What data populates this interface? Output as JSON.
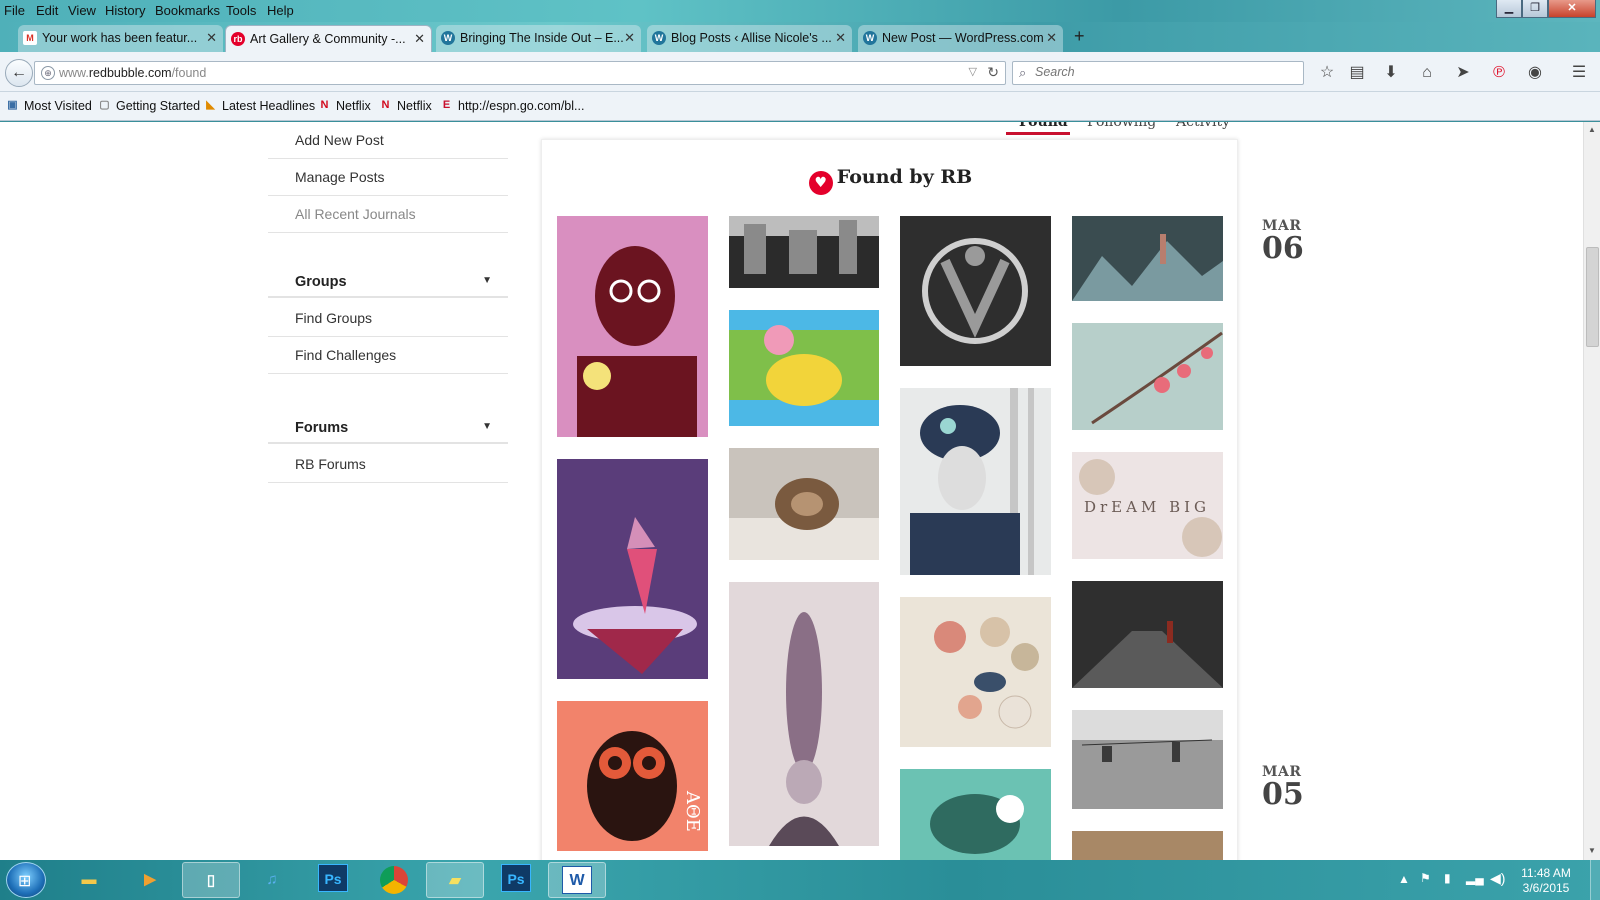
{
  "menubar": {
    "items": [
      "File",
      "Edit",
      "View",
      "History",
      "Bookmarks",
      "Tools",
      "Help"
    ],
    "window_controls": [
      "minimize",
      "restore",
      "close"
    ]
  },
  "tabs": [
    {
      "title": "Your work has been featur...",
      "icon": "gmail-icon",
      "color": "#d93025"
    },
    {
      "title": "Art Gallery & Community -...",
      "icon": "redbubble-icon",
      "color": "#e4002b"
    },
    {
      "title": "Bringing The Inside Out – E...",
      "icon": "wordpress-icon",
      "color": "#21759b"
    },
    {
      "title": "Blog Posts ‹ Allise Nicole's ...",
      "icon": "wordpress-icon",
      "color": "#21759b"
    },
    {
      "title": "New Post — WordPress.com",
      "icon": "wordpress-icon",
      "color": "#21759b"
    }
  ],
  "navbar": {
    "url_prefix": "www.",
    "url_domain": "redbubble.com",
    "url_path": "/found",
    "search_placeholder": "Search"
  },
  "bookmarks": [
    {
      "label": "Most Visited",
      "icon": "most-visited-icon"
    },
    {
      "label": "Getting Started",
      "icon": "page-icon"
    },
    {
      "label": "Latest Headlines",
      "icon": "rss-icon"
    },
    {
      "label": "Netflix",
      "icon": "netflix-icon"
    },
    {
      "label": "Netflix",
      "icon": "netflix-icon"
    },
    {
      "label": "http://espn.go.com/bl...",
      "icon": "espn-icon"
    }
  ],
  "sidebar": {
    "journal_links": [
      "Add New Post",
      "Manage Posts",
      "All Recent Journals"
    ],
    "groups": {
      "heading": "Groups",
      "links": [
        "Find Groups",
        "Find Challenges"
      ]
    },
    "forums": {
      "heading": "Forums",
      "links": [
        "RB Forums"
      ]
    }
  },
  "subtabs": [
    "Found",
    "Following",
    "Activity"
  ],
  "feed": {
    "title": "Found by RB",
    "brand_color": "#e4002b",
    "artworks": [
      {
        "bg": "#d98fc0",
        "fg": "#6b1420",
        "accent": "#f4e27a"
      },
      {
        "bg": "#5a3d7a",
        "fg": "#d9c6e8",
        "accent": "#e0507a"
      },
      {
        "bg": "#f2836b",
        "fg": "#2a1410",
        "accent": "#ffffff",
        "text": "ΑΘΕ"
      },
      {
        "bg": "#2e2e2e",
        "fg": "#9a9a9a",
        "accent": "#cfcfcf"
      },
      {
        "bg": "#4cb8e6",
        "fg": "#f2d43a",
        "accent": "#7fbf4a"
      },
      {
        "bg": "#c9c3bc",
        "fg": "#7a5a3f",
        "accent": "#e9e4de"
      },
      {
        "bg": "#e2d8da",
        "fg": "#8a6f86",
        "accent": "#5a4a58"
      },
      {
        "bg": "#2b2b2b",
        "fg": "#d7d7d7",
        "accent": "#8a8a8a"
      },
      {
        "bg": "#e8eaea",
        "fg": "#2a3a55",
        "accent": "#9ad6d2"
      },
      {
        "bg": "#ebe4d8",
        "fg": "#d9897a",
        "accent": "#3a4f6a"
      },
      {
        "bg": "#6bc2b3",
        "fg": "#2f6b60",
        "accent": "#ffffff"
      },
      {
        "bg": "#3a4c50",
        "fg": "#7a9aa0",
        "accent": "#b87e6e"
      },
      {
        "bg": "#b7cfca",
        "fg": "#e86c7a",
        "accent": "#6a4a3e"
      },
      {
        "bg": "#ede4e4",
        "fg": "#6b5b55",
        "accent": "#d7c6b8",
        "text": "DrEAM BIG"
      },
      {
        "bg": "#2f2f2f",
        "fg": "#8c2b20",
        "accent": "#5a5a5a"
      },
      {
        "bg": "#9a9a9a",
        "fg": "#3a3a3a",
        "accent": "#dcdcdc"
      },
      {
        "bg": "#a88866",
        "fg": "#7a5a40",
        "accent": "#c9a680"
      }
    ]
  },
  "dates": [
    {
      "month": "MAR",
      "day": "06"
    },
    {
      "month": "MAR",
      "day": "05"
    }
  ],
  "taskbar": {
    "items": [
      {
        "icon": "explorer-icon",
        "label": ""
      },
      {
        "icon": "media-player-icon",
        "label": ""
      },
      {
        "icon": "notepad-icon",
        "label": ""
      },
      {
        "icon": "itunes-icon",
        "label": ""
      },
      {
        "icon": "photoshop-icon",
        "label": "Ps"
      },
      {
        "icon": "chrome-icon",
        "label": ""
      },
      {
        "icon": "sticky-notes-icon",
        "label": ""
      },
      {
        "icon": "photoshop-icon",
        "label": "Ps"
      },
      {
        "icon": "word-icon",
        "label": "W"
      }
    ],
    "time": "11:48 AM",
    "date": "3/6/2015"
  }
}
